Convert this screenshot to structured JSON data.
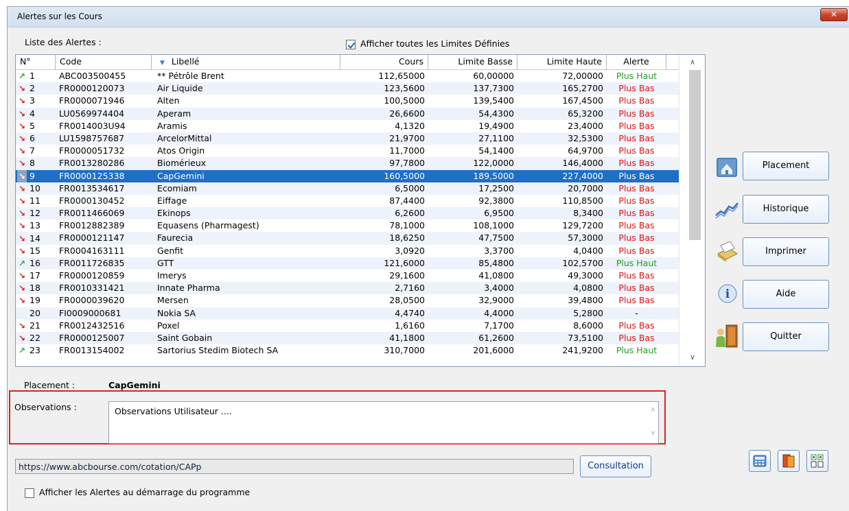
{
  "window": {
    "title": "Alertes sur les Cours",
    "close_glyph": "✕"
  },
  "list_label": "Liste des Alertes :",
  "show_all_limits": {
    "label": "Afficher toutes les Limites Définies",
    "checked": true
  },
  "columns": {
    "num": "N°",
    "code": "Code",
    "libelle": "Libellé",
    "cours": "Cours",
    "limite_basse": "Limite Basse",
    "limite_haute": "Limite Haute",
    "alerte": "Alerte"
  },
  "rows": [
    {
      "n": "1",
      "dir": "up",
      "code": "ABC003500455",
      "libelle": "** Pétrôle Brent",
      "cours": "112,65000",
      "lb": "60,00000",
      "lh": "72,00000",
      "alerte": "Plus Haut"
    },
    {
      "n": "2",
      "dir": "down",
      "code": "FR0000120073",
      "libelle": "Air Liquide",
      "cours": "123,5600",
      "lb": "137,7300",
      "lh": "165,2700",
      "alerte": "Plus Bas"
    },
    {
      "n": "3",
      "dir": "down",
      "code": "FR0000071946",
      "libelle": "Alten",
      "cours": "100,5000",
      "lb": "139,5400",
      "lh": "167,4500",
      "alerte": "Plus Bas"
    },
    {
      "n": "4",
      "dir": "down",
      "code": "LU0569974404",
      "libelle": "Aperam",
      "cours": "26,6600",
      "lb": "54,4300",
      "lh": "65,3200",
      "alerte": "Plus Bas"
    },
    {
      "n": "5",
      "dir": "down",
      "code": "FR0014003U94",
      "libelle": "Aramis",
      "cours": "4,1320",
      "lb": "19,4900",
      "lh": "23,4000",
      "alerte": "Plus Bas"
    },
    {
      "n": "6",
      "dir": "down",
      "code": "LU1598757687",
      "libelle": "ArcelorMittal",
      "cours": "21,9700",
      "lb": "27,1100",
      "lh": "32,5300",
      "alerte": "Plus Bas"
    },
    {
      "n": "7",
      "dir": "down",
      "code": "FR0000051732",
      "libelle": "Atos Origin",
      "cours": "11,7000",
      "lb": "54,1400",
      "lh": "64,9700",
      "alerte": "Plus Bas"
    },
    {
      "n": "8",
      "dir": "down",
      "code": "FR0013280286",
      "libelle": "Biomérieux",
      "cours": "97,7800",
      "lb": "122,0000",
      "lh": "146,4000",
      "alerte": "Plus Bas"
    },
    {
      "n": "9",
      "dir": "down",
      "code": "FR0000125338",
      "libelle": "CapGemini",
      "cours": "160,5000",
      "lb": "189,5000",
      "lh": "227,4000",
      "alerte": "Plus Bas",
      "selected": true
    },
    {
      "n": "10",
      "dir": "down",
      "code": "FR0013534617",
      "libelle": "Ecomiam",
      "cours": "6,5000",
      "lb": "17,2500",
      "lh": "20,7000",
      "alerte": "Plus Bas"
    },
    {
      "n": "11",
      "dir": "down",
      "code": "FR0000130452",
      "libelle": "Eiffage",
      "cours": "87,4400",
      "lb": "92,3800",
      "lh": "110,8500",
      "alerte": "Plus Bas"
    },
    {
      "n": "12",
      "dir": "down",
      "code": "FR0011466069",
      "libelle": "Ekinops",
      "cours": "6,2600",
      "lb": "6,9500",
      "lh": "8,3400",
      "alerte": "Plus Bas"
    },
    {
      "n": "13",
      "dir": "down",
      "code": "FR0012882389",
      "libelle": "Equasens (Pharmagest)",
      "cours": "78,1000",
      "lb": "108,1000",
      "lh": "129,7200",
      "alerte": "Plus Bas"
    },
    {
      "n": "14",
      "dir": "down",
      "code": "FR0000121147",
      "libelle": "Faurecia",
      "cours": "18,6250",
      "lb": "47,7500",
      "lh": "57,3000",
      "alerte": "Plus Bas"
    },
    {
      "n": "15",
      "dir": "down",
      "code": "FR0004163111",
      "libelle": "Genfit",
      "cours": "3,0920",
      "lb": "3,3700",
      "lh": "4,0400",
      "alerte": "Plus Bas"
    },
    {
      "n": "16",
      "dir": "up",
      "code": "FR0011726835",
      "libelle": "GTT",
      "cours": "121,6000",
      "lb": "85,4800",
      "lh": "102,5700",
      "alerte": "Plus Haut"
    },
    {
      "n": "17",
      "dir": "down",
      "code": "FR0000120859",
      "libelle": "Imerys",
      "cours": "29,1600",
      "lb": "41,0800",
      "lh": "49,3000",
      "alerte": "Plus Bas"
    },
    {
      "n": "18",
      "dir": "down",
      "code": "FR0010331421",
      "libelle": "Innate Pharma",
      "cours": "2,7160",
      "lb": "3,4000",
      "lh": "4,0800",
      "alerte": "Plus Bas"
    },
    {
      "n": "19",
      "dir": "down",
      "code": "FR0000039620",
      "libelle": "Mersen",
      "cours": "28,0500",
      "lb": "32,9000",
      "lh": "39,4800",
      "alerte": "Plus Bas"
    },
    {
      "n": "20",
      "dir": "none",
      "code": "FI0009000681",
      "libelle": "Nokia SA",
      "cours": "4,4740",
      "lb": "4,4000",
      "lh": "5,2800",
      "alerte": "-"
    },
    {
      "n": "21",
      "dir": "down",
      "code": "FR0012432516",
      "libelle": "Poxel",
      "cours": "1,6160",
      "lb": "7,1700",
      "lh": "8,6000",
      "alerte": "Plus Bas"
    },
    {
      "n": "22",
      "dir": "down",
      "code": "FR0000125007",
      "libelle": "Saint Gobain",
      "cours": "41,1800",
      "lb": "61,2600",
      "lh": "73,5100",
      "alerte": "Plus Bas"
    },
    {
      "n": "23",
      "dir": "up",
      "code": "FR0013154002",
      "libelle": "Sartorius Stedim Biotech SA",
      "cours": "310,7000",
      "lb": "201,6000",
      "lh": "241,9200",
      "alerte": "Plus Haut"
    }
  ],
  "placement": {
    "label": "Placement :",
    "value": "CapGemini"
  },
  "observations": {
    "label": "Observations :",
    "text": "Observations Utilisateur ...."
  },
  "url": "https://www.abcbourse.com/cotation/CAPp",
  "consult_label": "Consultation",
  "startup_alerts": {
    "label": "Afficher les Alertes au démarrage du programme",
    "checked": false
  },
  "side_buttons": {
    "placement": "Placement",
    "historique": "Historique",
    "imprimer": "Imprimer",
    "aide": "Aide",
    "quitter": "Quitter"
  },
  "icons": {
    "up_arrow": "↗",
    "down_arrow": "↘",
    "sort_arrow": "▼",
    "scroll_up": "∧",
    "scroll_down": "∨"
  },
  "colors": {
    "selection": "#1f6ec7",
    "alert_up": "#1e9a1e",
    "alert_down": "#e01010",
    "highlight_frame": "#e02020"
  }
}
